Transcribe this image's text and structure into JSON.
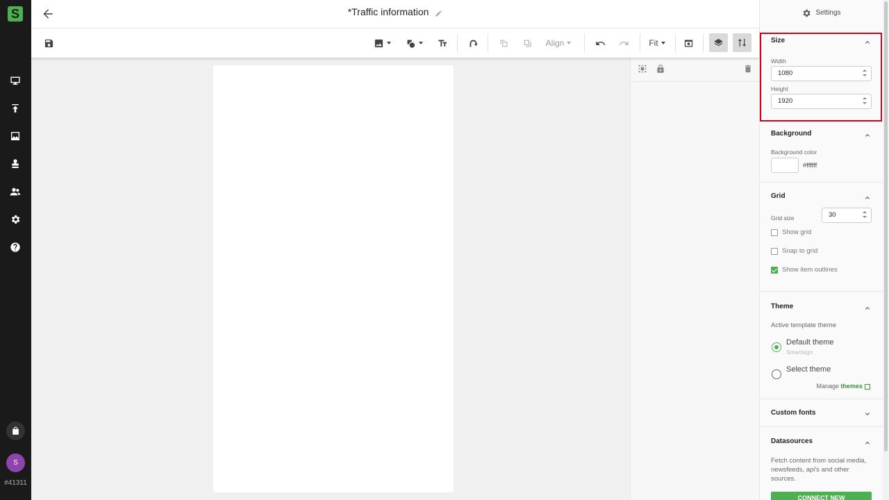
{
  "app": {
    "logo_letter": "S",
    "account_id": "#41311",
    "avatar_initial": "S"
  },
  "nav": {
    "icons": [
      "monitor-icon",
      "upload-icon",
      "image-icon",
      "stamp-icon",
      "users-icon",
      "gear-icon",
      "help-icon"
    ]
  },
  "document": {
    "modified_marker": "*",
    "title": "Traffic information"
  },
  "toolbar": {
    "align_label": "Align",
    "zoom_label": "Fit"
  },
  "settings": {
    "header": "Settings",
    "size": {
      "title": "Size",
      "width_label": "Width",
      "width_value": "1080",
      "height_label": "Height",
      "height_value": "1920"
    },
    "background": {
      "title": "Background",
      "color_label": "Background color",
      "color_value": "#ffffff"
    },
    "grid": {
      "title": "Grid",
      "size_label": "Grid size",
      "size_value": "30",
      "show_grid_label": "Show grid",
      "show_grid": false,
      "snap_label": "Snap to grid",
      "snap": false,
      "outlines_label": "Show item outlines",
      "outlines": true
    },
    "theme": {
      "title": "Theme",
      "active_label": "Active template theme",
      "default_label": "Default theme",
      "default_sub": "Smartsign",
      "select_label": "Select theme",
      "manage_prefix": "Manage ",
      "manage_link": "themes"
    },
    "custom_fonts": {
      "title": "Custom fonts"
    },
    "datasources": {
      "title": "Datasources",
      "description": "Fetch content from social media, newsfeeds, api's and other sources.",
      "connect_label": "CONNECT NEW"
    }
  },
  "colors": {
    "accent": "#4caf50",
    "highlight": "#d0021b",
    "nav_bg": "#1a1a1a",
    "avatar": "#8e44ad"
  }
}
